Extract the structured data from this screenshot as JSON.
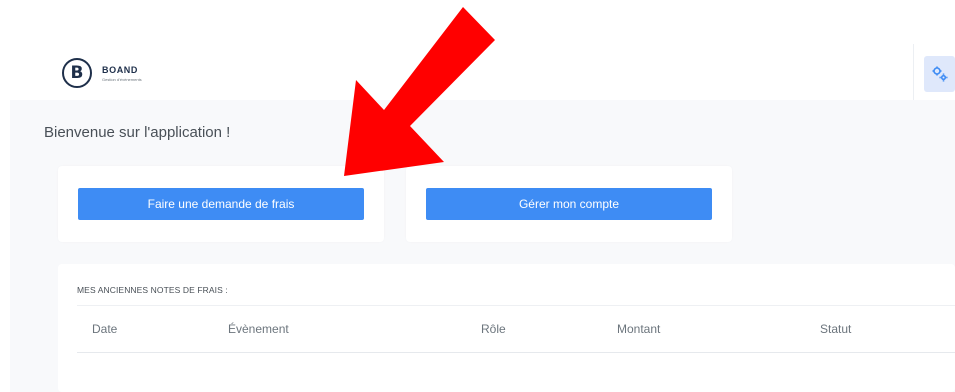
{
  "header": {
    "logo_letter": "B",
    "logo_name": "BOAND",
    "logo_subtitle": "Gestion d'évènements",
    "settings_icon": "gears-icon"
  },
  "main": {
    "welcome": "Bienvenue sur l'application !",
    "actions": {
      "request_expense": "Faire une demande de frais",
      "manage_account": "Gérer mon compte"
    },
    "expenses_table": {
      "title": "MES ANCIENNES NOTES DE FRAIS :",
      "columns": [
        "Date",
        "Évènement",
        "Rôle",
        "Montant",
        "Statut"
      ],
      "rows": []
    }
  },
  "colors": {
    "accent": "#3e8cf4",
    "annotation_arrow": "#ff0000",
    "background": "#f8f9fb"
  },
  "annotation": {
    "icon": "red-arrow-pointing-down-left"
  }
}
